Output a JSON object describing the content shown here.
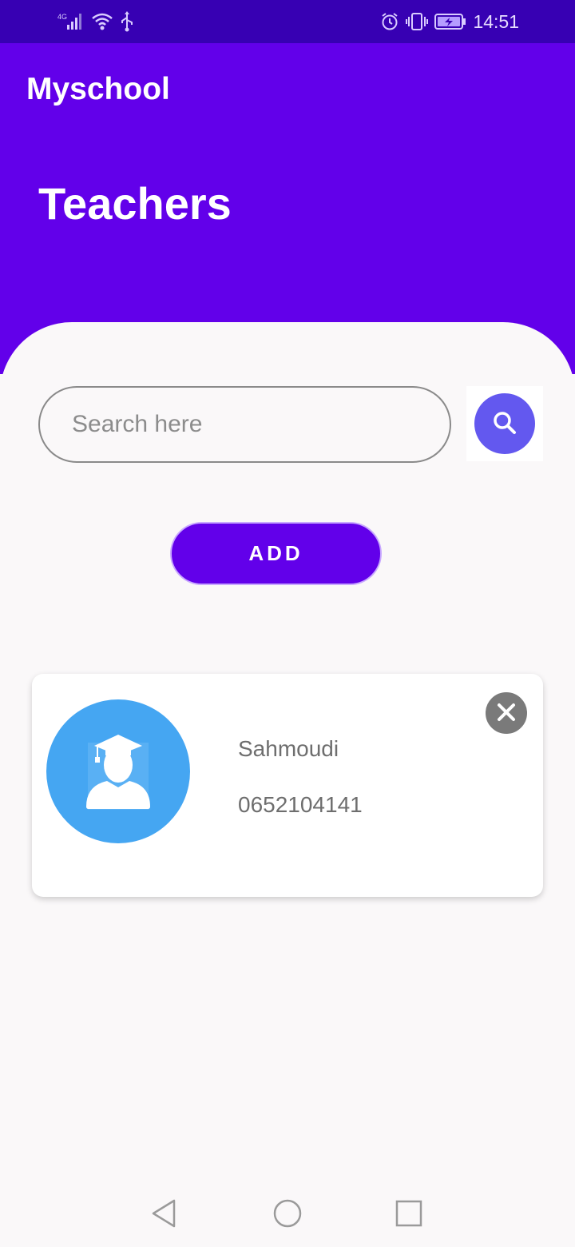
{
  "status_bar": {
    "network": "4G",
    "time": "14:51",
    "icons": [
      "signal-icon",
      "wifi-icon",
      "usb-icon",
      "alarm-icon",
      "vibrate-icon",
      "battery-charging-icon"
    ]
  },
  "app_bar": {
    "title": "Myschool"
  },
  "header": {
    "title": "Teachers"
  },
  "search": {
    "placeholder": "Search here",
    "value": "",
    "button_icon": "search-icon"
  },
  "actions": {
    "add_label": "ADD"
  },
  "teachers": [
    {
      "name": "Sahmoudi",
      "phone": "0652104141",
      "avatar_icon": "graduate-avatar-icon",
      "delete_icon": "close-icon"
    }
  ],
  "nav_bar": {
    "icons": [
      "back-icon",
      "home-icon",
      "recents-icon"
    ]
  },
  "colors": {
    "status_bar": "#3700b3",
    "primary": "#6200ea",
    "search_button": "#6358ef",
    "avatar_bg": "#45a6f2",
    "delete_bg": "#7a7a7a",
    "background": "#faf8f9"
  }
}
